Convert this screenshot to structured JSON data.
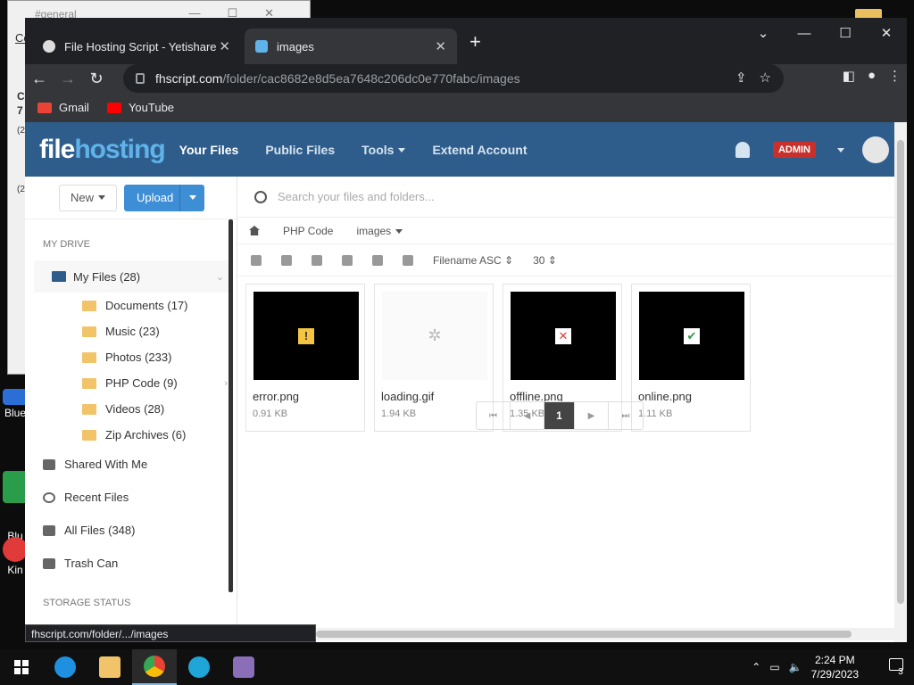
{
  "desktop": {
    "bg_window_title": "#general",
    "bg_window_letters": [
      "Co",
      "C",
      "7",
      "(2",
      "(2"
    ],
    "icons": [
      {
        "label": "Blue"
      },
      {
        "label": "Blu\nMul"
      },
      {
        "label": "Kin"
      }
    ]
  },
  "browser": {
    "tabs": [
      {
        "title": "File Hosting Script - Yetishare",
        "active": false
      },
      {
        "title": "images",
        "active": true
      }
    ],
    "new_tab": "+",
    "url_host": "fhscript.com",
    "url_path": "/folder/cac8682e8d5ea7648c206dc0e770fabc/images",
    "bookmarks": [
      {
        "label": "Gmail"
      },
      {
        "label": "YouTube"
      }
    ],
    "status_tip": "fhscript.com/folder/.../images"
  },
  "site": {
    "logo_a": "file",
    "logo_b": "hosting",
    "nav": [
      "Your Files",
      "Public Files",
      "Tools",
      "Extend Account"
    ],
    "admin_badge": "ADMIN",
    "btn_new": "New",
    "btn_upload": "Upload",
    "search_placeholder": "Search your files and folders...",
    "section_my_drive": "MY DRIVE",
    "my_files": "My Files (28)",
    "folders": [
      "Documents (17)",
      "Music (23)",
      "Photos (233)",
      "PHP Code (9)",
      "Videos (28)",
      "Zip Archives (6)"
    ],
    "side_links": [
      "Shared With Me",
      "Recent Files",
      "All Files (348)",
      "Trash Can"
    ],
    "section_storage": "STORAGE STATUS",
    "breadcrumb": [
      "PHP Code",
      "images"
    ],
    "sort": "Filename ASC",
    "per_page": "30",
    "files": [
      {
        "name": "error.png",
        "size": "0.91 KB",
        "icon": "warning-icon",
        "dark": true
      },
      {
        "name": "loading.gif",
        "size": "1.94 KB",
        "icon": "spinner-icon",
        "dark": false
      },
      {
        "name": "offline.png",
        "size": "1.35 KB",
        "icon": "cross-icon",
        "dark": true
      },
      {
        "name": "online.png",
        "size": "1.11 KB",
        "icon": "check-icon",
        "dark": true
      }
    ],
    "pager": {
      "current": "1"
    }
  },
  "taskbar": {
    "time": "2:24 PM",
    "date": "7/29/2023",
    "notif_count": "3"
  }
}
